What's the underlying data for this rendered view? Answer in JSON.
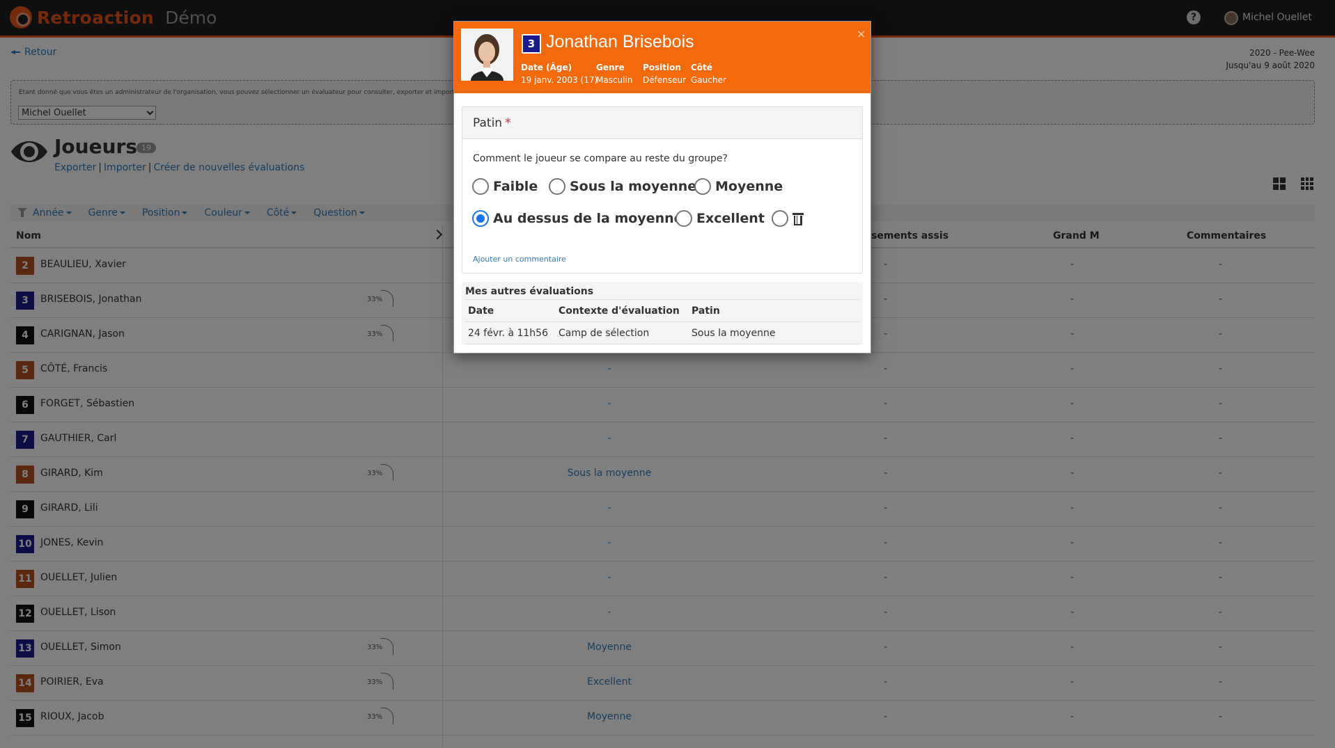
{
  "header": {
    "brand": "Retroaction",
    "demo": "Démo",
    "user_name": "Michel Ouellet"
  },
  "back_label": "Retour",
  "season": {
    "line1": "2020 - Pee-Wee",
    "line2": "Jusqu'au 9 août 2020"
  },
  "admin": {
    "text": "Étant donné que vous êtes un administrateur de l'organisation, vous pouvez sélectionner un évaluateur pour consulter, exporter et importer ses",
    "selected_evaluator": "Michel Ouellet"
  },
  "page": {
    "title": "Joueurs",
    "count": "19",
    "links": [
      "Exporter",
      "Importer",
      "Créer de nouvelles évaluations"
    ]
  },
  "filters": [
    "Année",
    "Genre",
    "Position",
    "Couleur",
    "Côté",
    "Question"
  ],
  "columns": {
    "name": "Nom",
    "seated": "sements assis",
    "grand_m": "Grand M",
    "comments": "Commentaires"
  },
  "colors": {
    "orange": "#b5501c",
    "navy": "#1a1a8c",
    "black": "#111111",
    "accent": "#f26a0c"
  },
  "players": [
    {
      "num": "2",
      "name": "BEAULIEU, Xavier",
      "color": "orange",
      "progress": "",
      "eval": ""
    },
    {
      "num": "3",
      "name": "BRISEBOIS, Jonathan",
      "color": "navy",
      "progress": "33%",
      "eval": ""
    },
    {
      "num": "4",
      "name": "CARIGNAN, Jason",
      "color": "black",
      "progress": "33%",
      "eval": ""
    },
    {
      "num": "5",
      "name": "CÔTÉ, Francis",
      "color": "orange",
      "progress": "",
      "eval": "-"
    },
    {
      "num": "6",
      "name": "FORGET, Sébastien",
      "color": "black",
      "progress": "",
      "eval": "-"
    },
    {
      "num": "7",
      "name": "GAUTHIER, Carl",
      "color": "navy",
      "progress": "",
      "eval": "-"
    },
    {
      "num": "8",
      "name": "GIRARD, Kim",
      "color": "orange",
      "progress": "33%",
      "eval": "Sous la moyenne"
    },
    {
      "num": "9",
      "name": "GIRARD, Lili",
      "color": "black",
      "progress": "",
      "eval": "-"
    },
    {
      "num": "10",
      "name": "JONES, Kevin",
      "color": "navy",
      "progress": "",
      "eval": "-"
    },
    {
      "num": "11",
      "name": "OUELLET, Julien",
      "color": "orange",
      "progress": "",
      "eval": "-"
    },
    {
      "num": "12",
      "name": "OUELLET, Lison",
      "color": "black",
      "progress": "",
      "eval": "-"
    },
    {
      "num": "13",
      "name": "OUELLET, Simon",
      "color": "navy",
      "progress": "33%",
      "eval": "Moyenne"
    },
    {
      "num": "14",
      "name": "POIRIER, Eva",
      "color": "orange",
      "progress": "33%",
      "eval": "Excellent"
    },
    {
      "num": "15",
      "name": "RIOUX, Jacob",
      "color": "black",
      "progress": "33%",
      "eval": "Moyenne"
    }
  ],
  "dash": "-",
  "modal": {
    "number": "3",
    "name": "Jonathan Brisebois",
    "meta": [
      {
        "label": "Date (Âge)",
        "value": "19 janv. 2003 (17)"
      },
      {
        "label": "Genre",
        "value": "Masculin"
      },
      {
        "label": "Position",
        "value": "Défenseur"
      },
      {
        "label": "Côté",
        "value": "Gaucher"
      }
    ],
    "close": "×",
    "section_title": "Patin",
    "required_mark": "*",
    "question": "Comment le joueur se compare au reste du groupe?",
    "options": [
      "Faible",
      "Sous la moyenne",
      "Moyenne",
      "Au dessus de la moyenne",
      "Excellent"
    ],
    "selected_option": "Au dessus de la moyenne",
    "add_comment": "Ajouter un commentaire",
    "others_title": "Mes autres évaluations",
    "others_headers": [
      "Date",
      "Contexte d'évaluation",
      "Patin"
    ],
    "others_rows": [
      [
        "24 févr. à 11h56",
        "Camp de sélection",
        "Sous la moyenne"
      ]
    ]
  }
}
